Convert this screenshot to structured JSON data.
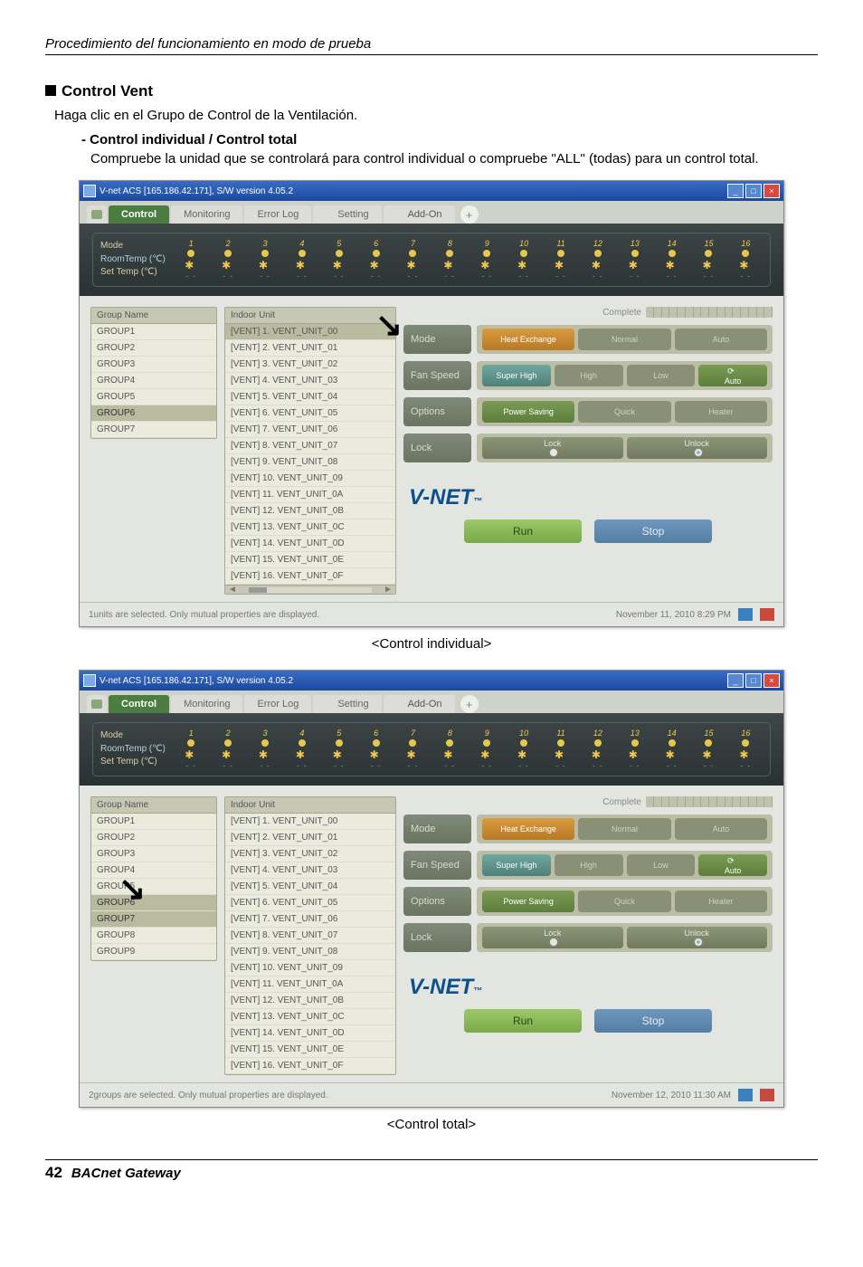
{
  "page": {
    "header": "Procedimiento del funcionamiento en modo de prueba",
    "section_title": "Control Vent",
    "intro": "Haga clic en el Grupo de Control de la Ventilación.",
    "sub_title": "- Control individual / Control total",
    "sub_text": "Compruebe la unidad que se controlará para control individual o compruebe \"ALL\" (todas) para un control total.",
    "caption1": "<Control individual>",
    "caption2": "<Control total>",
    "footer_page": "42",
    "footer_label": "BACnet Gateway"
  },
  "app": {
    "title": "V-net ACS [165.186.42.171],   S/W version 4.05.2",
    "tabs": {
      "home": "Home",
      "control": "Control",
      "monitoring": "Monitoring",
      "errorlog": "Error Log",
      "setting": "Setting",
      "addon": "Add-On"
    },
    "status_labels": {
      "mode": "Mode",
      "roomtemp": "RoomTemp (℃)",
      "settemp": "Set Temp   (℃)"
    },
    "unit_numbers": [
      "1",
      "2",
      "3",
      "4",
      "5",
      "6",
      "7",
      "8",
      "9",
      "10",
      "11",
      "12",
      "13",
      "14",
      "15",
      "16"
    ],
    "group_header": "Group Name",
    "groups": [
      "GROUP1",
      "GROUP2",
      "GROUP3",
      "GROUP4",
      "GROUP5",
      "GROUP6",
      "GROUP7"
    ],
    "groups2": [
      "GROUP1",
      "GROUP2",
      "GROUP3",
      "GROUP4",
      "GROUP5",
      "GROUP6",
      "GROUP7",
      "GROUP8",
      "GROUP9"
    ],
    "unit_header": "Indoor Unit",
    "units": [
      "[VENT] 1. VENT_UNIT_00",
      "[VENT] 2. VENT_UNIT_01",
      "[VENT] 3. VENT_UNIT_02",
      "[VENT] 4. VENT_UNIT_03",
      "[VENT] 5. VENT_UNIT_04",
      "[VENT] 6. VENT_UNIT_05",
      "[VENT] 7. VENT_UNIT_06",
      "[VENT] 8. VENT_UNIT_07",
      "[VENT] 9. VENT_UNIT_08",
      "[VENT] 10. VENT_UNIT_09",
      "[VENT] 11. VENT_UNIT_0A",
      "[VENT] 12. VENT_UNIT_0B",
      "[VENT] 13. VENT_UNIT_0C",
      "[VENT] 14. VENT_UNIT_0D",
      "[VENT] 15. VENT_UNIT_0E",
      "[VENT] 16. VENT_UNIT_0F"
    ],
    "complete": "Complete",
    "ctrl": {
      "mode": "Mode",
      "mode_btns": {
        "heat": "Heat Exchange",
        "normal": "Normal",
        "auto": "Auto"
      },
      "fan": "Fan Speed",
      "fan_btns": {
        "super": "Super High",
        "high": "High",
        "low": "Low",
        "auto": "Auto"
      },
      "options": "Options",
      "opt_btns": {
        "power": "Power Saving",
        "quick": "Quick",
        "heater": "Heater"
      },
      "lock": "Lock",
      "lock_btns": {
        "lock": "Lock",
        "unlock": "Unlock"
      }
    },
    "logo": "V-NET",
    "logo_tm": "™",
    "run": "Run",
    "stop": "Stop",
    "statusbar1": "1units are selected. Only mutual properties are displayed.",
    "statusbar2": "2groups are selected. Only mutual properties are displayed.",
    "datetime1": "November 11, 2010  8:29 PM",
    "datetime2": "November 12, 2010  11:30 AM"
  }
}
